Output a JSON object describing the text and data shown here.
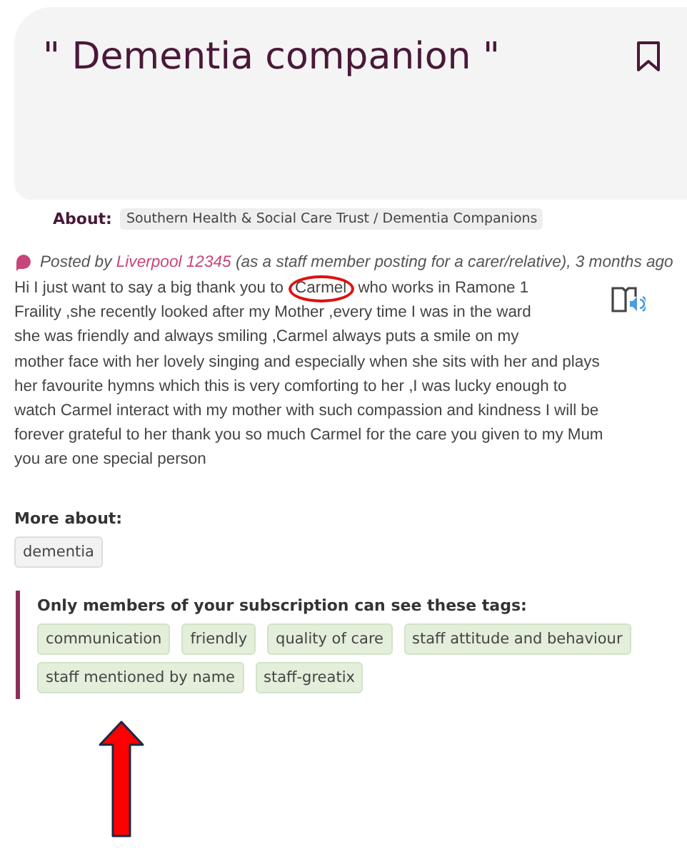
{
  "header": {
    "title": "\" Dementia companion \"",
    "bookmarked": false
  },
  "about": {
    "label": "About:",
    "value": "Southern Health & Social Care Trust / Dementia Companions"
  },
  "posted": {
    "prefix": "Posted by",
    "author": "Liverpool 12345",
    "suffix": "(as a staff member posting for a carer/relative), 3 months ago"
  },
  "story": {
    "first_line": {
      "before": "Hi I just want to say a big thank you to",
      "circled": "Carmel",
      "after": "who works in Ramone 1"
    },
    "lines": [
      "Fraility ,she recently looked after  my Mother ,every time I was in the ward",
      "she was friendly and always smiling ,Carmel always puts a smile  on my",
      "mother face with her lovely singing and especially when she sits with her and plays",
      "her favourite hymns which this is very comforting to her ,I was lucky enough to",
      "watch Carmel interact with my mother with such compassion and kindness I will be",
      "forever grateful to her  thank you so much Carmel for the care you given to my Mum",
      "you are one special person"
    ]
  },
  "more_about": {
    "label": "More about:",
    "tags": [
      "dementia"
    ]
  },
  "member_tags": {
    "heading": "Only members of your subscription can see these tags:",
    "tags": [
      "communication",
      "friendly",
      "quality of care",
      "staff attitude and behaviour",
      "staff mentioned by name",
      "staff-greatix"
    ]
  }
}
